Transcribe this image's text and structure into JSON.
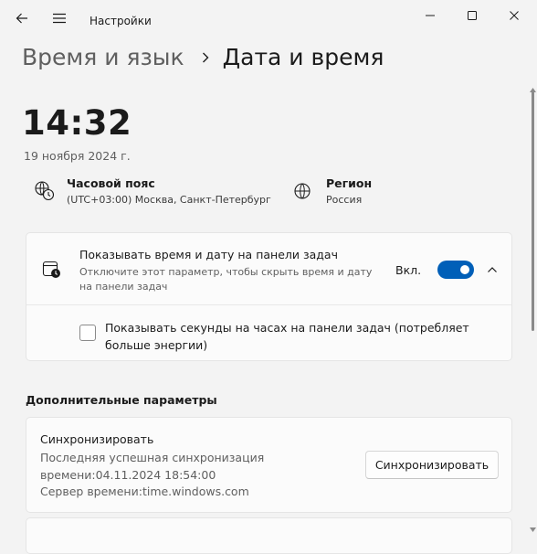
{
  "titlebar": {
    "app_title": "Настройки",
    "back_icon": "back-arrow-icon",
    "menu_icon": "hamburger-icon",
    "window_controls": [
      "minimize-icon",
      "maximize-icon",
      "close-icon"
    ]
  },
  "breadcrumb": {
    "parent": "Время и язык",
    "separator_icon": "chevron-right-icon",
    "current": "Дата и время"
  },
  "clock": {
    "time": "14:32",
    "date": "19 ноября 2024 г."
  },
  "info": {
    "timezone": {
      "icon": "globe-clock-icon",
      "label": "Часовой пояс",
      "value": "(UTC+03:00) Москва, Санкт-Петербург"
    },
    "region": {
      "icon": "globe-icon",
      "label": "Регион",
      "value": "Россия"
    }
  },
  "taskbar_setting": {
    "icon": "calendar-clock-icon",
    "title": "Показывать время и дату на панели задач",
    "description": "Отключите этот параметр, чтобы скрыть время и дату на панели задач",
    "state_label": "Вкл.",
    "toggle_on": true,
    "expand_icon": "chevron-up-icon",
    "seconds_option": {
      "checked": false,
      "label": "Показывать секунды на часах на панели задач (потребляет больше энергии)"
    }
  },
  "additional": {
    "section_title": "Дополнительные параметры",
    "sync": {
      "title": "Синхронизировать",
      "last_sync": "Последняя успешная синхронизация времени:04.11.2024 18:54:00",
      "server": "Сервер времени:time.windows.com",
      "button_label": "Синхронизировать"
    }
  },
  "colors": {
    "accent": "#005fb8",
    "background": "#f3f3f3",
    "card": "#fbfbfb"
  }
}
